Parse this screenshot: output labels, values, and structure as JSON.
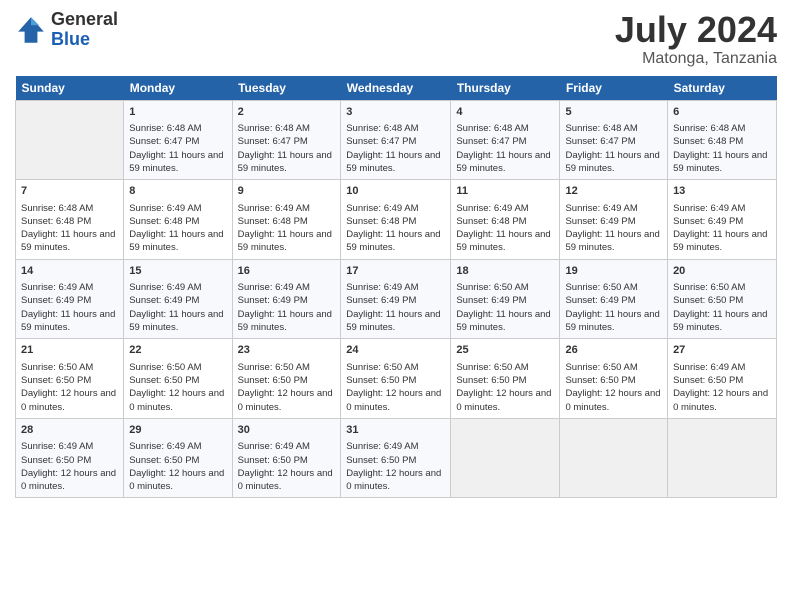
{
  "logo": {
    "general": "General",
    "blue": "Blue"
  },
  "header": {
    "month": "July 2024",
    "location": "Matonga, Tanzania"
  },
  "weekdays": [
    "Sunday",
    "Monday",
    "Tuesday",
    "Wednesday",
    "Thursday",
    "Friday",
    "Saturday"
  ],
  "weeks": [
    [
      {
        "day": "",
        "text": ""
      },
      {
        "day": "1",
        "text": "Sunrise: 6:48 AM\nSunset: 6:47 PM\nDaylight: 11 hours and 59 minutes."
      },
      {
        "day": "2",
        "text": "Sunrise: 6:48 AM\nSunset: 6:47 PM\nDaylight: 11 hours and 59 minutes."
      },
      {
        "day": "3",
        "text": "Sunrise: 6:48 AM\nSunset: 6:47 PM\nDaylight: 11 hours and 59 minutes."
      },
      {
        "day": "4",
        "text": "Sunrise: 6:48 AM\nSunset: 6:47 PM\nDaylight: 11 hours and 59 minutes."
      },
      {
        "day": "5",
        "text": "Sunrise: 6:48 AM\nSunset: 6:47 PM\nDaylight: 11 hours and 59 minutes."
      },
      {
        "day": "6",
        "text": "Sunrise: 6:48 AM\nSunset: 6:48 PM\nDaylight: 11 hours and 59 minutes."
      }
    ],
    [
      {
        "day": "7",
        "text": "Sunrise: 6:48 AM\nSunset: 6:48 PM\nDaylight: 11 hours and 59 minutes."
      },
      {
        "day": "8",
        "text": "Sunrise: 6:49 AM\nSunset: 6:48 PM\nDaylight: 11 hours and 59 minutes."
      },
      {
        "day": "9",
        "text": "Sunrise: 6:49 AM\nSunset: 6:48 PM\nDaylight: 11 hours and 59 minutes."
      },
      {
        "day": "10",
        "text": "Sunrise: 6:49 AM\nSunset: 6:48 PM\nDaylight: 11 hours and 59 minutes."
      },
      {
        "day": "11",
        "text": "Sunrise: 6:49 AM\nSunset: 6:48 PM\nDaylight: 11 hours and 59 minutes."
      },
      {
        "day": "12",
        "text": "Sunrise: 6:49 AM\nSunset: 6:49 PM\nDaylight: 11 hours and 59 minutes."
      },
      {
        "day": "13",
        "text": "Sunrise: 6:49 AM\nSunset: 6:49 PM\nDaylight: 11 hours and 59 minutes."
      }
    ],
    [
      {
        "day": "14",
        "text": "Sunrise: 6:49 AM\nSunset: 6:49 PM\nDaylight: 11 hours and 59 minutes."
      },
      {
        "day": "15",
        "text": "Sunrise: 6:49 AM\nSunset: 6:49 PM\nDaylight: 11 hours and 59 minutes."
      },
      {
        "day": "16",
        "text": "Sunrise: 6:49 AM\nSunset: 6:49 PM\nDaylight: 11 hours and 59 minutes."
      },
      {
        "day": "17",
        "text": "Sunrise: 6:49 AM\nSunset: 6:49 PM\nDaylight: 11 hours and 59 minutes."
      },
      {
        "day": "18",
        "text": "Sunrise: 6:50 AM\nSunset: 6:49 PM\nDaylight: 11 hours and 59 minutes."
      },
      {
        "day": "19",
        "text": "Sunrise: 6:50 AM\nSunset: 6:49 PM\nDaylight: 11 hours and 59 minutes."
      },
      {
        "day": "20",
        "text": "Sunrise: 6:50 AM\nSunset: 6:50 PM\nDaylight: 11 hours and 59 minutes."
      }
    ],
    [
      {
        "day": "21",
        "text": "Sunrise: 6:50 AM\nSunset: 6:50 PM\nDaylight: 12 hours and 0 minutes."
      },
      {
        "day": "22",
        "text": "Sunrise: 6:50 AM\nSunset: 6:50 PM\nDaylight: 12 hours and 0 minutes."
      },
      {
        "day": "23",
        "text": "Sunrise: 6:50 AM\nSunset: 6:50 PM\nDaylight: 12 hours and 0 minutes."
      },
      {
        "day": "24",
        "text": "Sunrise: 6:50 AM\nSunset: 6:50 PM\nDaylight: 12 hours and 0 minutes."
      },
      {
        "day": "25",
        "text": "Sunrise: 6:50 AM\nSunset: 6:50 PM\nDaylight: 12 hours and 0 minutes."
      },
      {
        "day": "26",
        "text": "Sunrise: 6:50 AM\nSunset: 6:50 PM\nDaylight: 12 hours and 0 minutes."
      },
      {
        "day": "27",
        "text": "Sunrise: 6:49 AM\nSunset: 6:50 PM\nDaylight: 12 hours and 0 minutes."
      }
    ],
    [
      {
        "day": "28",
        "text": "Sunrise: 6:49 AM\nSunset: 6:50 PM\nDaylight: 12 hours and 0 minutes."
      },
      {
        "day": "29",
        "text": "Sunrise: 6:49 AM\nSunset: 6:50 PM\nDaylight: 12 hours and 0 minutes."
      },
      {
        "day": "30",
        "text": "Sunrise: 6:49 AM\nSunset: 6:50 PM\nDaylight: 12 hours and 0 minutes."
      },
      {
        "day": "31",
        "text": "Sunrise: 6:49 AM\nSunset: 6:50 PM\nDaylight: 12 hours and 0 minutes."
      },
      {
        "day": "",
        "text": ""
      },
      {
        "day": "",
        "text": ""
      },
      {
        "day": "",
        "text": ""
      }
    ]
  ]
}
